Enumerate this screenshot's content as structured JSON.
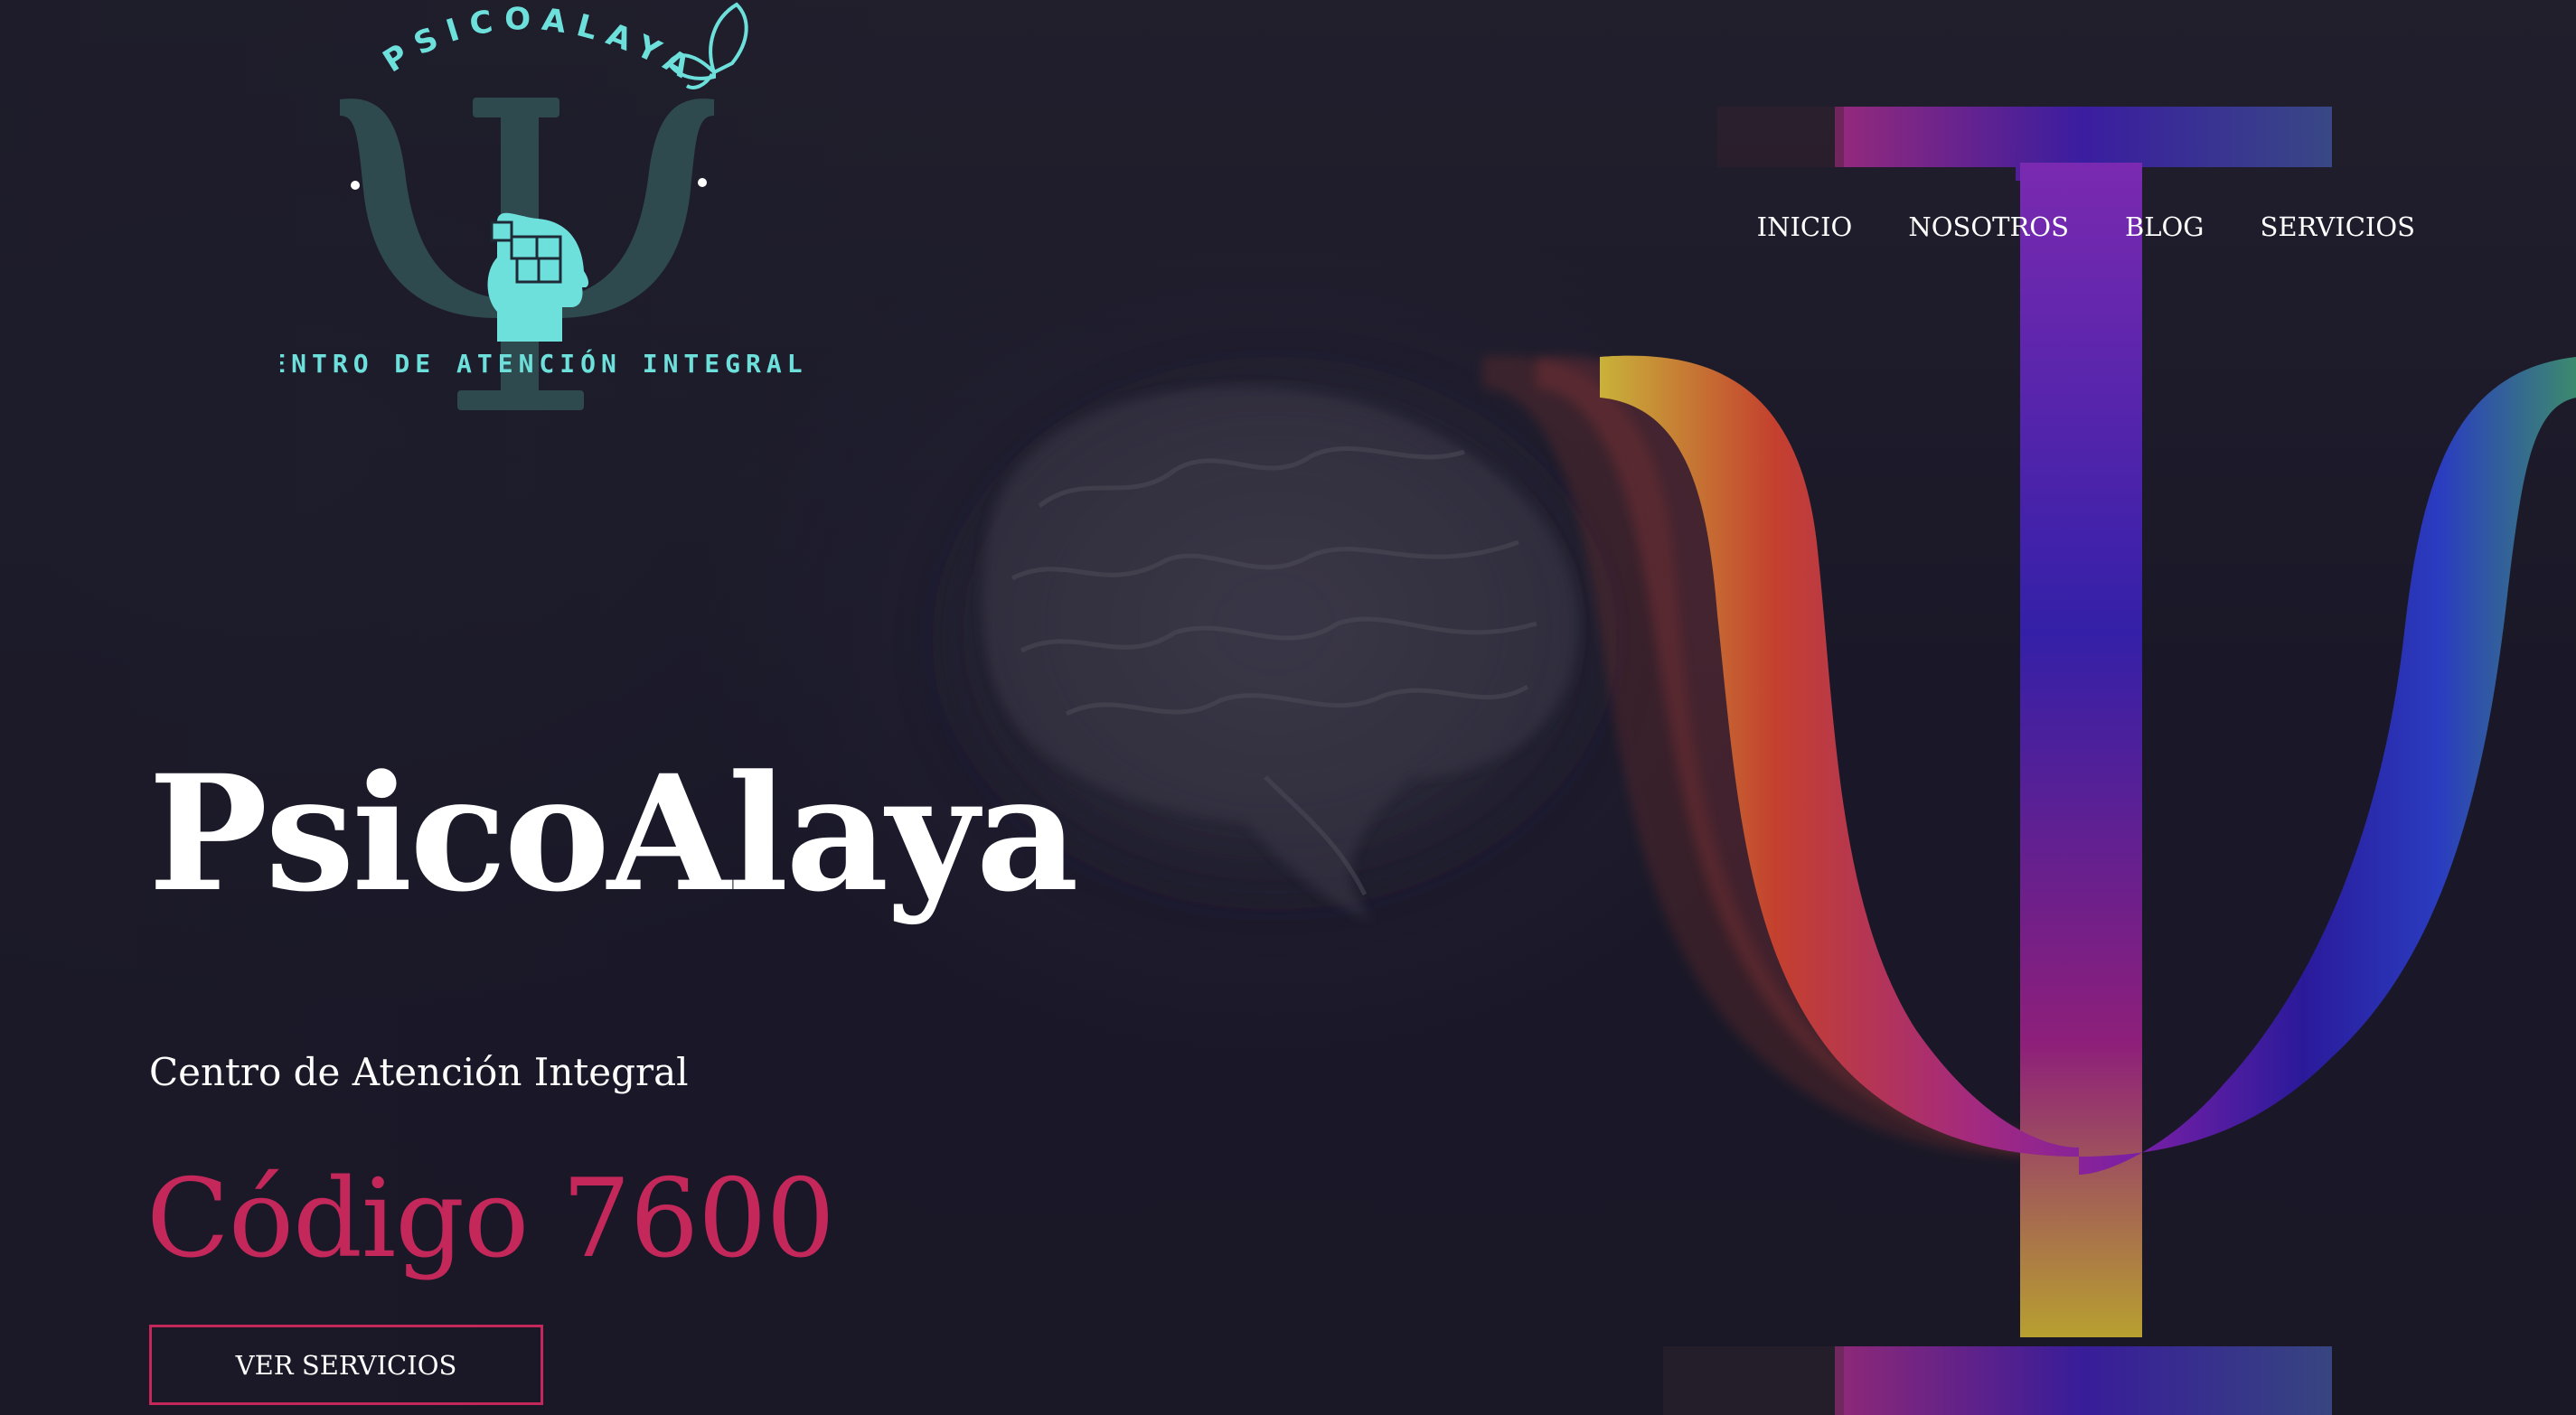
{
  "logo": {
    "arc_text": "PSICOALAYA",
    "tagline": "CENTRO DE ATENCIÓN INTEGRAL",
    "icon": "psi-head-puzzle-icon",
    "butterfly_icon": "butterfly-icon",
    "accent_color": "#6ee0dc",
    "psi_color": "#2e4a4e"
  },
  "nav": {
    "items": [
      {
        "label": "INICIO"
      },
      {
        "label": "NOSOTROS"
      },
      {
        "label": "BLOG"
      },
      {
        "label": "SERVICIOS"
      }
    ]
  },
  "hero": {
    "title": "PsicoAlaya",
    "subtitle": "Centro de Atención Integral",
    "code": "Código 7600",
    "cta_label": "VER SERVICIOS",
    "accent_color": "#c4285a",
    "background_images": [
      "brain-image",
      "rainbow-psi-symbol"
    ]
  }
}
